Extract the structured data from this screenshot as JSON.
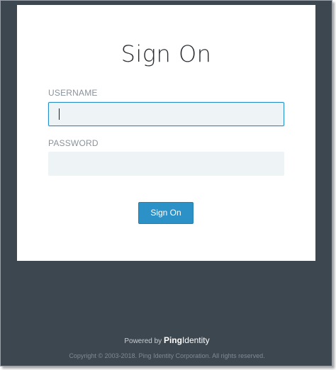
{
  "title": "Sign On",
  "username": {
    "label": "USERNAME",
    "value": ""
  },
  "password": {
    "label": "PASSWORD",
    "value": ""
  },
  "submit_label": "Sign On",
  "footer": {
    "powered_by": "Powered by",
    "brand_bold": "Ping",
    "brand_light": "Identity",
    "copyright": "Copyright © 2003-2018. Ping Identity Corporation. All rights reserved."
  },
  "colors": {
    "background": "#3d4750",
    "card": "#ffffff",
    "input_bg": "#eef3f6",
    "focus_border": "#2a8fc7",
    "button": "#2b91c6"
  }
}
